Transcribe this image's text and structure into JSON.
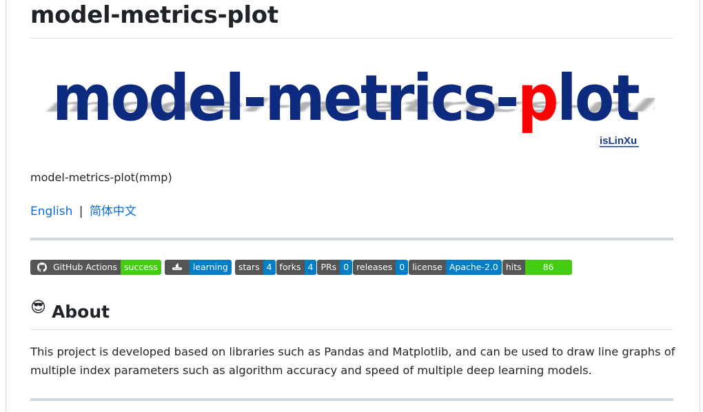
{
  "page": {
    "title": "model-metrics-plot"
  },
  "banner": {
    "text_main": "model-metrics-",
    "text_accent": "p",
    "text_tail": "lot",
    "author": "isLinXu",
    "colors": {
      "main": "#0d2b7e",
      "accent": "#ff0000",
      "author": "#1a3a8c"
    }
  },
  "subtitle": "model-metrics-plot(mmp)",
  "languages": {
    "english": "English",
    "separator": "|",
    "chinese": "简体中文"
  },
  "badges": [
    {
      "name": "github-actions",
      "label": "GitHub Actions",
      "value": "success",
      "icon": "github-icon",
      "value_color": "#44cc11"
    },
    {
      "name": "learning",
      "label": "",
      "value": "learning",
      "icon": "submarine-icon",
      "value_color": "#007ec6"
    },
    {
      "name": "stars",
      "label": "stars",
      "value": "4",
      "value_color": "#007ec6"
    },
    {
      "name": "forks",
      "label": "forks",
      "value": "4",
      "value_color": "#007ec6"
    },
    {
      "name": "prs",
      "label": "PRs",
      "value": "0",
      "value_color": "#007ec6"
    },
    {
      "name": "releases",
      "label": "releases",
      "value": "0",
      "value_color": "#007ec6"
    },
    {
      "name": "license",
      "label": "license",
      "value": "Apache-2.0",
      "value_color": "#007ec6"
    },
    {
      "name": "hits",
      "label": "hits",
      "value": "86",
      "value_color": "#44cc11"
    }
  ],
  "about": {
    "emoji": "😎",
    "heading": "About",
    "description": "This project is developed based on libraries such as Pandas and Matplotlib, and can be used to draw line graphs of multiple index parameters such as algorithm accuracy and speed of multiple deep learning models."
  }
}
